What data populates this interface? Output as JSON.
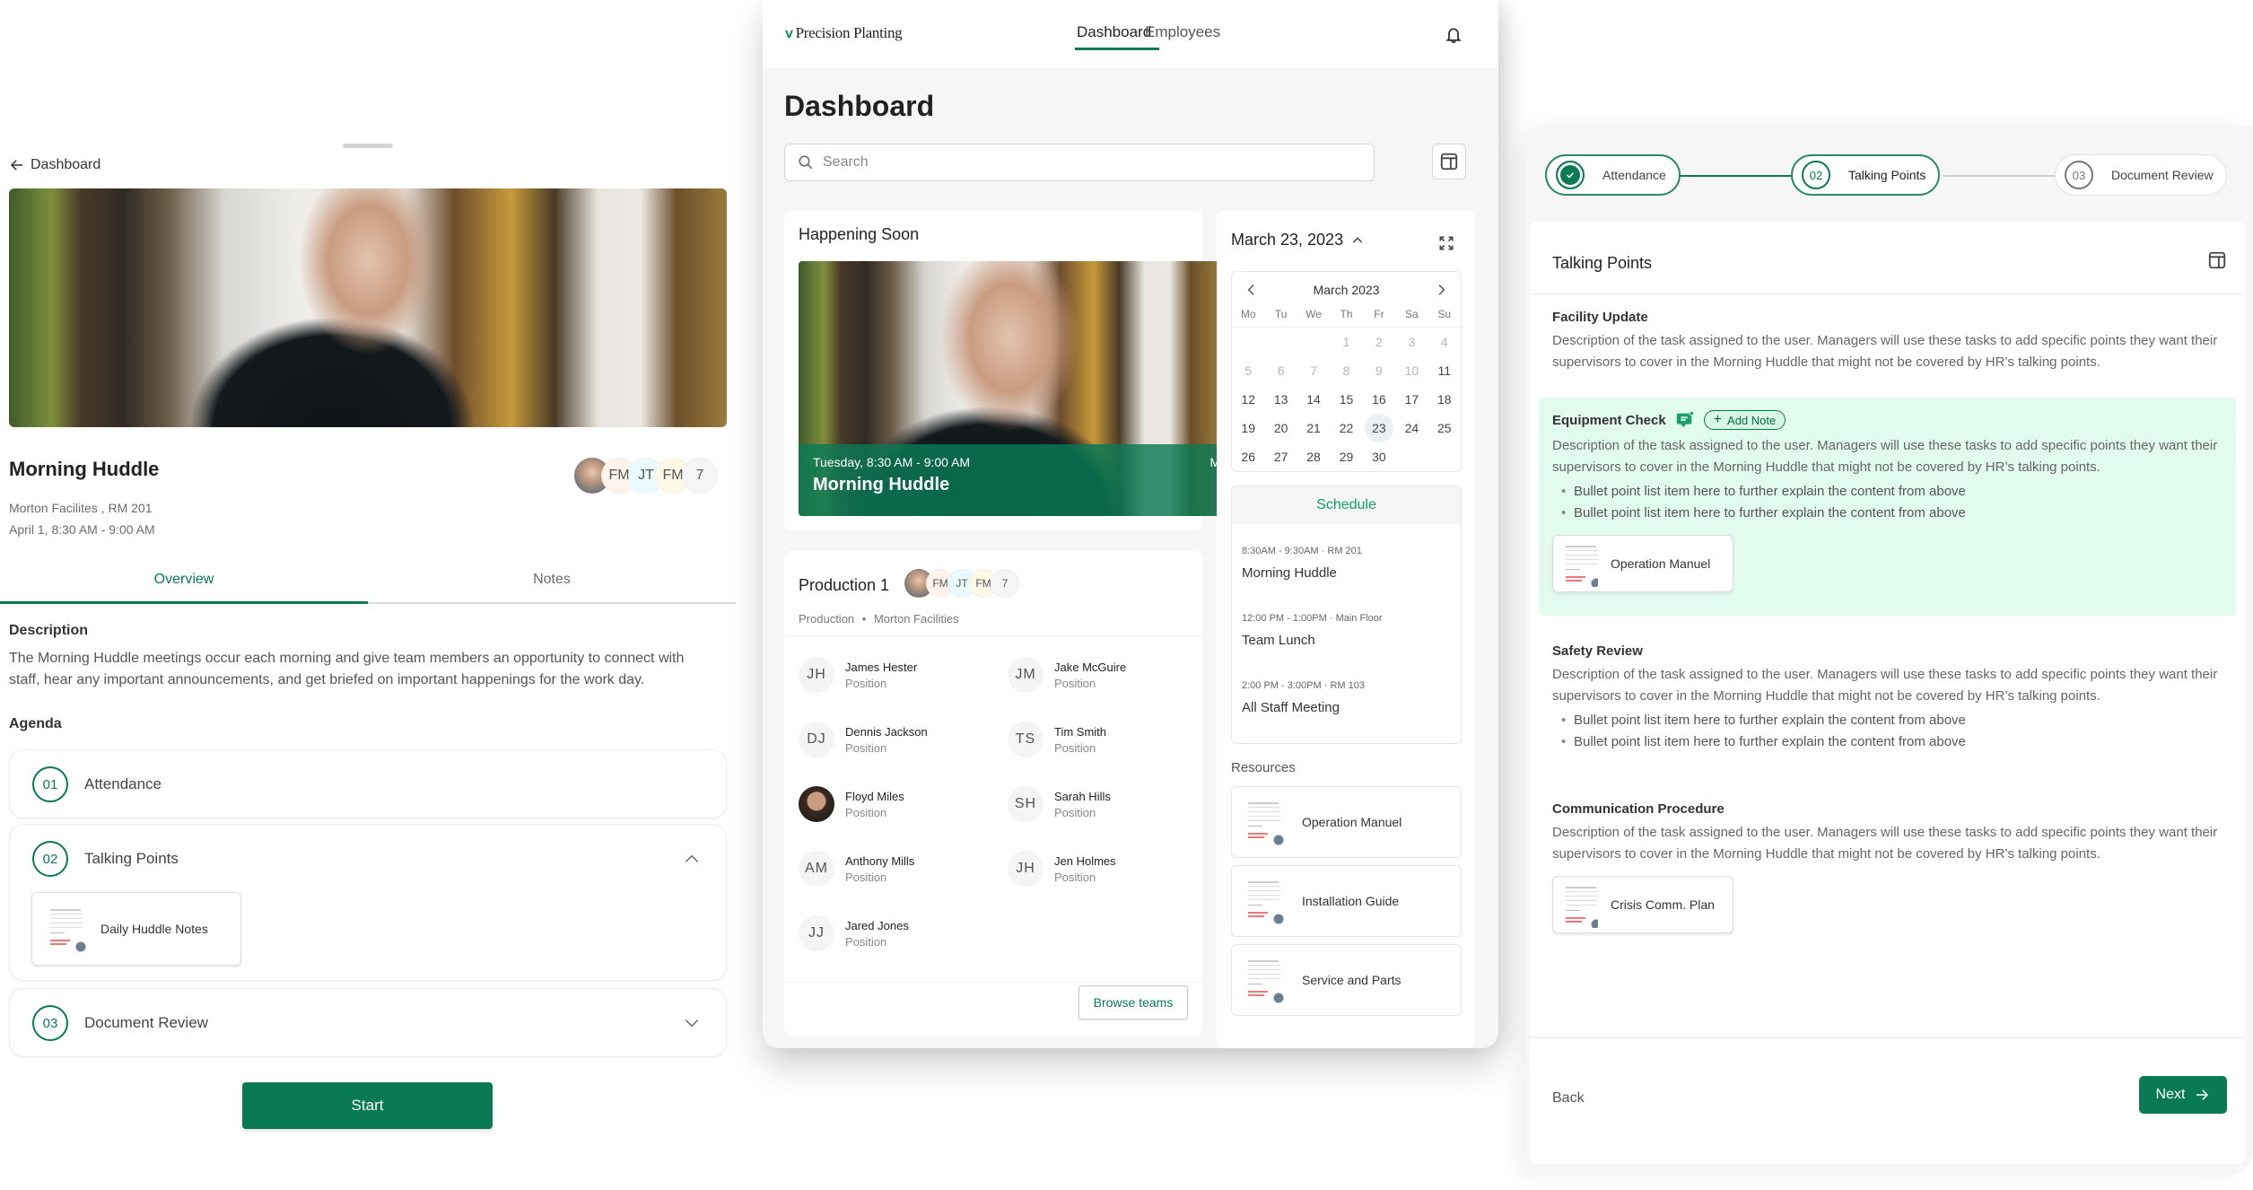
{
  "left": {
    "back_label": "Dashboard",
    "event": {
      "title": "Morning Huddle",
      "location": "Morton Facilites , RM 201",
      "datetime": "April 1, 8:30 AM - 9:00 AM",
      "attendees": [
        "FM",
        "JT",
        "FM"
      ],
      "attendee_count": "7"
    },
    "tabs": [
      {
        "label": "Overview",
        "active": true
      },
      {
        "label": "Notes",
        "active": false
      }
    ],
    "description_label": "Description",
    "description": "The Morning Huddle meetings occur each morning and give team members an opportunity to connect with staff, hear any important announcements, and get briefed on important happenings for the work day.",
    "agenda_label": "Agenda",
    "agenda": [
      {
        "number": "01",
        "label": "Attendance"
      },
      {
        "number": "02",
        "label": "Talking Points",
        "expanded": true,
        "document": "Daily Huddle Notes"
      },
      {
        "number": "03",
        "label": "Document Review"
      }
    ],
    "start_label": "Start"
  },
  "mid": {
    "brand": "Precision Planting",
    "nav": [
      {
        "label": "Dashboard",
        "active": true
      },
      {
        "label": "Employees",
        "active": false
      }
    ],
    "page_title": "Dashboard",
    "search": {
      "placeholder": "Search",
      "value": ""
    },
    "happening": {
      "title": "Happening Soon",
      "when": "Tuesday, 8:30 AM - 9:00 AM",
      "what": "Morning Huddle",
      "next_peek": "M"
    },
    "calendar": {
      "selected_date": "March 23, 2023",
      "month_label": "March 2023",
      "weekdays": [
        "Mo",
        "Tu",
        "We",
        "Th",
        "Fr",
        "Sa",
        "Su"
      ],
      "leading_blanks": 3,
      "days_in_month": 30,
      "muted_through": 10,
      "selected_day": 23
    },
    "schedule": {
      "title": "Schedule",
      "items": [
        {
          "time": "8:30AM - 9:30AM",
          "place": "RM 201",
          "name": "Morning Huddle"
        },
        {
          "time": "12:00 PM - 1:00PM",
          "place": "Main Floor",
          "name": "Team Lunch"
        },
        {
          "time": "2:00 PM - 3:00PM",
          "place": "RM 103",
          "name": "All Staff Meeting"
        }
      ]
    },
    "resources": {
      "title": "Resources",
      "items": [
        "Operation Manuel",
        "Installation Guide",
        "Service and Parts"
      ]
    },
    "production": {
      "title": "Production 1",
      "avatars": [
        "FM",
        "JT",
        "FM"
      ],
      "avatar_count": "7",
      "subtitle_dept": "Production",
      "subtitle_site": "Morton Facilities",
      "members": [
        {
          "initials": "JH",
          "name": "James Hester",
          "position": "Position"
        },
        {
          "initials": "JM",
          "name": "Jake McGuire",
          "position": "Position"
        },
        {
          "initials": "DJ",
          "name": "Dennis Jackson",
          "position": "Position"
        },
        {
          "initials": "TS",
          "name": "Tim Smith",
          "position": "Position"
        },
        {
          "initials": "",
          "name": "Floyd Miles",
          "position": "Position",
          "photo": true
        },
        {
          "initials": "SH",
          "name": "Sarah Hills",
          "position": "Position"
        },
        {
          "initials": "AM",
          "name": "Anthony Mills",
          "position": "Position"
        },
        {
          "initials": "JH",
          "name": "Jen Holmes",
          "position": "Position"
        },
        {
          "initials": "JJ",
          "name": "Jared Jones",
          "position": "Position"
        }
      ],
      "browse_label": "Browse teams"
    }
  },
  "right": {
    "steps": [
      {
        "number": "",
        "label": "Attendance",
        "state": "done"
      },
      {
        "number": "02",
        "label": "Talking Points",
        "state": "current"
      },
      {
        "number": "03",
        "label": "Document Review",
        "state": "pending"
      }
    ],
    "card_title": "Talking Points",
    "sections": [
      {
        "title": "Facility Update",
        "text": "Description of the task assigned to the user. Managers will use these tasks to add specific points they want their supervisors to cover in the Morning Huddle that might not be covered by HR’s talking points.",
        "bullets": [],
        "document": ""
      },
      {
        "title": "Equipment Check",
        "highlighted": true,
        "add_note_label": "Add Note",
        "text": "Description of the task assigned to the user. Managers will use these tasks to add specific points they want their supervisors to cover in the Morning Huddle that might not be covered by HR’s talking points.",
        "bullets": [
          "Bullet point list item here to further explain the content from above",
          "Bullet point list item here to further explain the content from above"
        ],
        "document": "Operation Manuel"
      },
      {
        "title": "Safety Review",
        "text": "Description of the task assigned to the user. Managers will use these tasks to add specific points they want their supervisors to cover in the Morning Huddle that might not be covered by HR’s talking points.",
        "bullets": [
          "Bullet point list item here to further explain the content from above",
          "Bullet point list item here to further explain the content from above"
        ],
        "document": ""
      },
      {
        "title": "Communication Procedure",
        "text": "Description of the task assigned to the user. Managers will use these tasks to add specific points they want their supervisors to cover in the Morning Huddle that might not be covered by HR’s talking points.",
        "bullets": [],
        "document": "Crisis Comm. Plan"
      }
    ],
    "back_label": "Back",
    "next_label": "Next"
  },
  "colors": {
    "brand_green": "#0a7a55",
    "highlight_bg": "#e2fbef",
    "schedule_title": "#10a070"
  }
}
